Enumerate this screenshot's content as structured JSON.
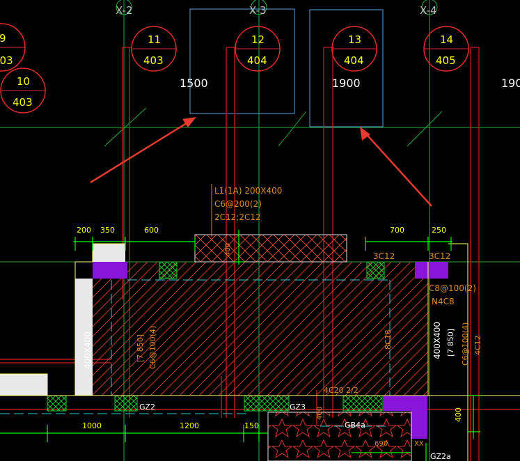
{
  "axes": [
    {
      "id": "x2",
      "label": "X-2"
    },
    {
      "id": "x3",
      "label": "X-3"
    },
    {
      "id": "x4",
      "label": "X-4"
    }
  ],
  "rooms": [
    {
      "num": "9",
      "code": "403"
    },
    {
      "num": "11",
      "code": "403"
    },
    {
      "num": "12",
      "code": "404"
    },
    {
      "num": "13",
      "code": "404"
    },
    {
      "num": "14",
      "code": "405"
    },
    {
      "num": "10",
      "code": "403"
    }
  ],
  "opening_widths": [
    "1500",
    "1900",
    "190"
  ],
  "beam_label": {
    "line1": "L1(1A) 200X400",
    "line2": "C6@200(2)",
    "line3": "2C12;2C12"
  },
  "top_dims": [
    "200",
    "350",
    "600",
    "700",
    "250"
  ],
  "bottom_dims": [
    "1000",
    "1200",
    "150",
    "400"
  ],
  "rebar": {
    "c12_left": "3C12",
    "c12_right": "3C12",
    "stirrup_right": "C8@100(2)",
    "main_right": "N4C8",
    "side_mid": "8C18",
    "bottom_beam": "4C20 2/2",
    "vertical_400": "400"
  },
  "column_left": {
    "size": "400X400",
    "ref": "[7 850]",
    "stirrup": "C6@100(4)"
  },
  "column_right": {
    "size": "400X400",
    "ref": "[7 850]",
    "stirrup": "C6@100(4)",
    "main": "4C12"
  },
  "tags": [
    "GZ2",
    "GZ3",
    "GB4a",
    "GZ2a"
  ],
  "misc_labels": [
    "690",
    "XX"
  ],
  "colors": {
    "background": "#000000",
    "axis_green": "#1fae3a",
    "wall_red": "#d42020",
    "outline_cyan": "#36c6d6",
    "dim_green": "#00ff00",
    "fill_magenta": "#8a14d8",
    "window_blue": "#5aa0e0",
    "text_yellow": "#ffff00",
    "text_orange": "#e08a1e"
  }
}
